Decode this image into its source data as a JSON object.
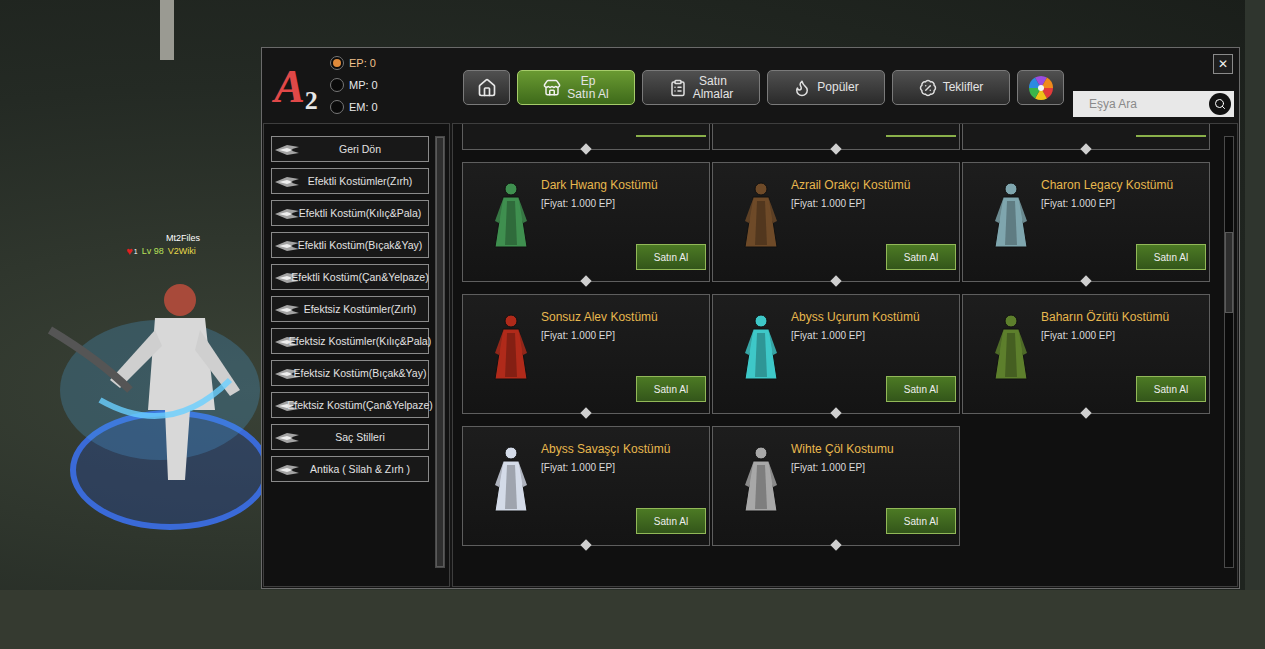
{
  "player": {
    "name": "Mt2Files",
    "badge": "1",
    "level": "Lv 98",
    "guild": "V2Wiki"
  },
  "window": {
    "logo": {
      "letter": "A",
      "number": "2"
    },
    "close": "✕"
  },
  "currencies": [
    {
      "label": "EP: 0",
      "selected": true
    },
    {
      "label": "MP: 0",
      "selected": false
    },
    {
      "label": "EM: 0",
      "selected": false
    }
  ],
  "toolbar": [
    {
      "kind": "icon",
      "lines": [],
      "selected": false
    },
    {
      "kind": "text",
      "lines": [
        "Ep",
        "Satın Al"
      ],
      "selected": true
    },
    {
      "kind": "text",
      "lines": [
        "Satın",
        "Almalar"
      ],
      "selected": false
    },
    {
      "kind": "text",
      "lines": [
        "Popüler"
      ],
      "selected": false
    },
    {
      "kind": "text",
      "lines": [
        "Teklifler"
      ],
      "selected": false
    },
    {
      "kind": "icon",
      "lines": [],
      "selected": false
    }
  ],
  "search": {
    "placeholder": "Eşya Ara"
  },
  "sidebar": {
    "items": [
      {
        "label": "Geri Dön",
        "selected": false
      },
      {
        "label": "Efektli Kostümler(Zırh)",
        "selected": false
      },
      {
        "label": "Efektli Kostüm(Kılıç&Pala)",
        "selected": false
      },
      {
        "label": "Efektli Kostüm(Bıçak&Yay)",
        "selected": false
      },
      {
        "label": "Efektli Kostüm(Çan&Yelpaze)",
        "selected": false
      },
      {
        "label": "Efektsiz Kostümler(Zırh)",
        "selected": false
      },
      {
        "label": "Efektsiz Kostümler(Kılıç&Pala)",
        "selected": false
      },
      {
        "label": "Efektsiz Kostüm(Bıçak&Yay)",
        "selected": false
      },
      {
        "label": "Efektsiz Kostüm(Çan&Yelpaze)",
        "selected": false
      },
      {
        "label": "Saç Stilleri",
        "selected": false
      },
      {
        "label": "Antika ( Silah & Zırh )",
        "selected": false
      }
    ],
    "scrollbar": {
      "position": 0,
      "size": 1
    }
  },
  "shop": {
    "scrolled_row": {
      "count": 3
    },
    "scrollbar": {
      "position": 0.22,
      "size": 0.19
    },
    "items": [
      {
        "name": "Dark Hwang Kostümü",
        "price": "[Fiyat: 1.000 EP]",
        "button": "Satın Al",
        "color": "#3f8f4f"
      },
      {
        "name": "Azrail Orakçı Kostümü",
        "price": "[Fiyat: 1.000 EP]",
        "button": "Satın Al",
        "color": "#6e4a28"
      },
      {
        "name": "Charon Legacy Kostümü",
        "price": "[Fiyat: 1.000 EP]",
        "button": "Satın Al",
        "color": "#7fa6ae"
      },
      {
        "name": "Sonsuz Alev Kostümü",
        "price": "[Fiyat: 1.000 EP]",
        "button": "Satın Al",
        "color": "#b02a1a"
      },
      {
        "name": "Abyss Uçurum Kostümü",
        "price": "[Fiyat: 1.000 EP]",
        "button": "Satın Al",
        "color": "#3ec8c8"
      },
      {
        "name": "Baharın Özütü Kostümü",
        "price": "[Fiyat: 1.000 EP]",
        "button": "Satın Al",
        "color": "#5d7f2c"
      },
      {
        "name": "Abyss Savaşçı Kostümü",
        "price": "[Fiyat: 1.000 EP]",
        "button": "Satın Al",
        "color": "#d4dbe8"
      },
      {
        "name": "Wihte Çöl Kostumu",
        "price": "[Fiyat: 1.000 EP]",
        "button": "Satın Al",
        "color": "#a8a8a8"
      }
    ]
  }
}
